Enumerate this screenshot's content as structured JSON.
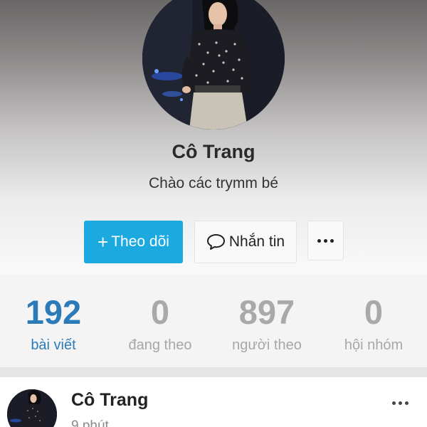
{
  "profile": {
    "name": "Cô Trang",
    "bio": "Chào các trymm bé",
    "avatar_alt": "profile photo"
  },
  "actions": {
    "follow_icon": "+",
    "follow_label": "Theo dõi",
    "message_icon": "speech-bubble-icon",
    "message_label": "Nhắn tin",
    "more_icon": "more-dots-icon"
  },
  "stats": [
    {
      "value": "192",
      "label": "bài viết",
      "active": true
    },
    {
      "value": "0",
      "label": "đang theo",
      "active": false
    },
    {
      "value": "897",
      "label": "người theo",
      "active": false
    },
    {
      "value": "0",
      "label": "hội nhóm",
      "active": false
    }
  ],
  "post": {
    "author": "Cô Trang",
    "time": "9 phút",
    "more_icon": "more-dots-icon"
  },
  "colors": {
    "accent": "#1ba9e0",
    "active_stat": "#2b7bb9",
    "inactive_stat": "#a9a9a9"
  }
}
